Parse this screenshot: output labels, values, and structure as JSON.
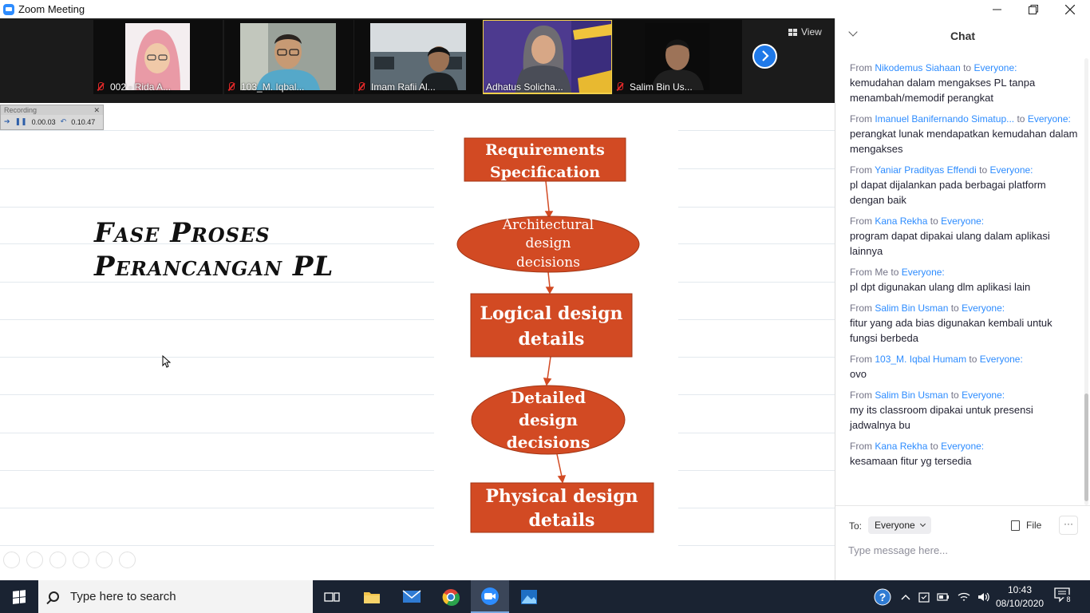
{
  "window": {
    "title": "Zoom Meeting"
  },
  "participants": [
    {
      "name": "002 - Rida A...",
      "mic": "muted"
    },
    {
      "name": "103_M. Iqbal...",
      "mic": "muted"
    },
    {
      "name": "Imam Rafii Al...",
      "mic": "muted"
    },
    {
      "name": "Adhatus Solicha...",
      "mic": "active"
    },
    {
      "name": "Salim Bin Us...",
      "mic": "muted"
    }
  ],
  "view_label": "View",
  "recording": {
    "label": "Recording",
    "elapsed": "0.00.03",
    "total": "0.10.47"
  },
  "slide": {
    "title_line1": "Fase Proses",
    "title_line2": "Perancangan PL",
    "steps": [
      "Requirements Specification",
      "Architectural design decisions",
      "Logical design details",
      "Detailed design decisions",
      "Physical design details"
    ],
    "diagram_color": "#d24a23"
  },
  "chat": {
    "title": "Chat",
    "messages": [
      {
        "from": "Nikodemus Siahaan",
        "to": "Everyone:",
        "text": "kemudahan dalam mengakses PL tanpa menambah/memodif perangkat"
      },
      {
        "from": "Imanuel Banifernando Simatup...",
        "to": "Everyone:",
        "text": "perangkat lunak mendapatkan kemudahan dalam mengakses"
      },
      {
        "from": "Yaniar Pradityas Effendi",
        "to": "Everyone:",
        "text": "pl dapat dijalankan pada berbagai platform dengan baik"
      },
      {
        "from": "Kana Rekha",
        "to": "Everyone:",
        "text": "program dapat dipakai ulang dalam aplikasi lainnya"
      },
      {
        "from": "Me",
        "to": "Everyone:",
        "text": "pl dpt digunakan ulang dlm aplikasi lain"
      },
      {
        "from": "Salim Bin Usman",
        "to": "Everyone:",
        "text": "fitur yang ada bias digunakan kembali untuk fungsi berbeda"
      },
      {
        "from": "103_M. Iqbal Humam",
        "to": "Everyone:",
        "text": "ovo"
      },
      {
        "from": "Salim Bin Usman",
        "to": "Everyone:",
        "text": "my its classroom dipakai untuk presensi jadwalnya bu"
      },
      {
        "from": "Kana Rekha",
        "to": "Everyone:",
        "text": "kesamaan fitur yg tersedia"
      }
    ],
    "from_word": "From",
    "to_word": "to",
    "to_label": "To:",
    "recipient": "Everyone",
    "file_label": "File",
    "more_label": "···",
    "input_placeholder": "Type message here..."
  },
  "taskbar": {
    "search_placeholder": "Type here to search",
    "time": "10:43",
    "date": "08/10/2020",
    "notification_count": "8",
    "accent": "#1a2332"
  }
}
